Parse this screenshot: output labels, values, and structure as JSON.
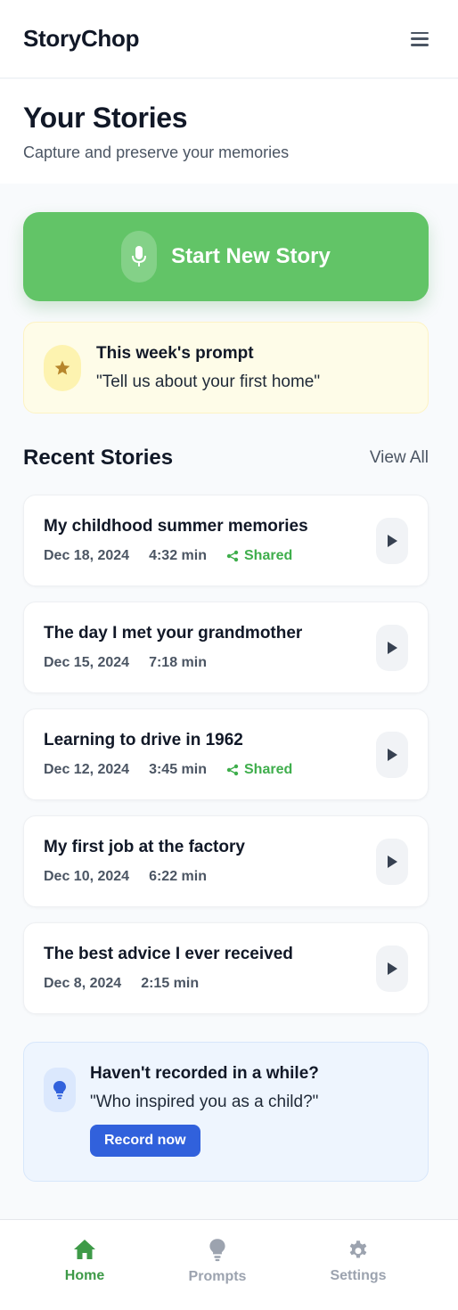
{
  "header": {
    "brand": "StoryChop",
    "menu_icon": "hamburger-icon"
  },
  "hero": {
    "title": "Your Stories",
    "subtitle": "Capture and preserve your memories"
  },
  "start_button": {
    "label": "Start New Story",
    "icon": "microphone-icon",
    "color": "#62c467"
  },
  "weekly_prompt": {
    "title": "This week's prompt",
    "quote": "\"Tell us about your first home\"",
    "icon": "star-icon"
  },
  "recent": {
    "title": "Recent Stories",
    "view_all": "View All",
    "stories": [
      {
        "title": "My childhood summer memories",
        "date": "Dec 18, 2024",
        "duration": "4:32 min",
        "shared": "Shared"
      },
      {
        "title": "The day I met your grandmother",
        "date": "Dec 15, 2024",
        "duration": "7:18 min",
        "shared": ""
      },
      {
        "title": "Learning to drive in 1962",
        "date": "Dec 12, 2024",
        "duration": "3:45 min",
        "shared": "Shared"
      },
      {
        "title": "My first job at the factory",
        "date": "Dec 10, 2024",
        "duration": "6:22 min",
        "shared": ""
      },
      {
        "title": "The best advice I ever received",
        "date": "Dec 8, 2024",
        "duration": "2:15 min",
        "shared": ""
      }
    ]
  },
  "nudge": {
    "title": "Haven't recorded in a while?",
    "quote": "\"Who inspired you as a child?\"",
    "button": "Record now",
    "icon": "lightbulb-icon",
    "accent": "#3161dc"
  },
  "nav": {
    "home": "Home",
    "prompts": "Prompts",
    "settings": "Settings",
    "active_color": "#3e9a48"
  }
}
